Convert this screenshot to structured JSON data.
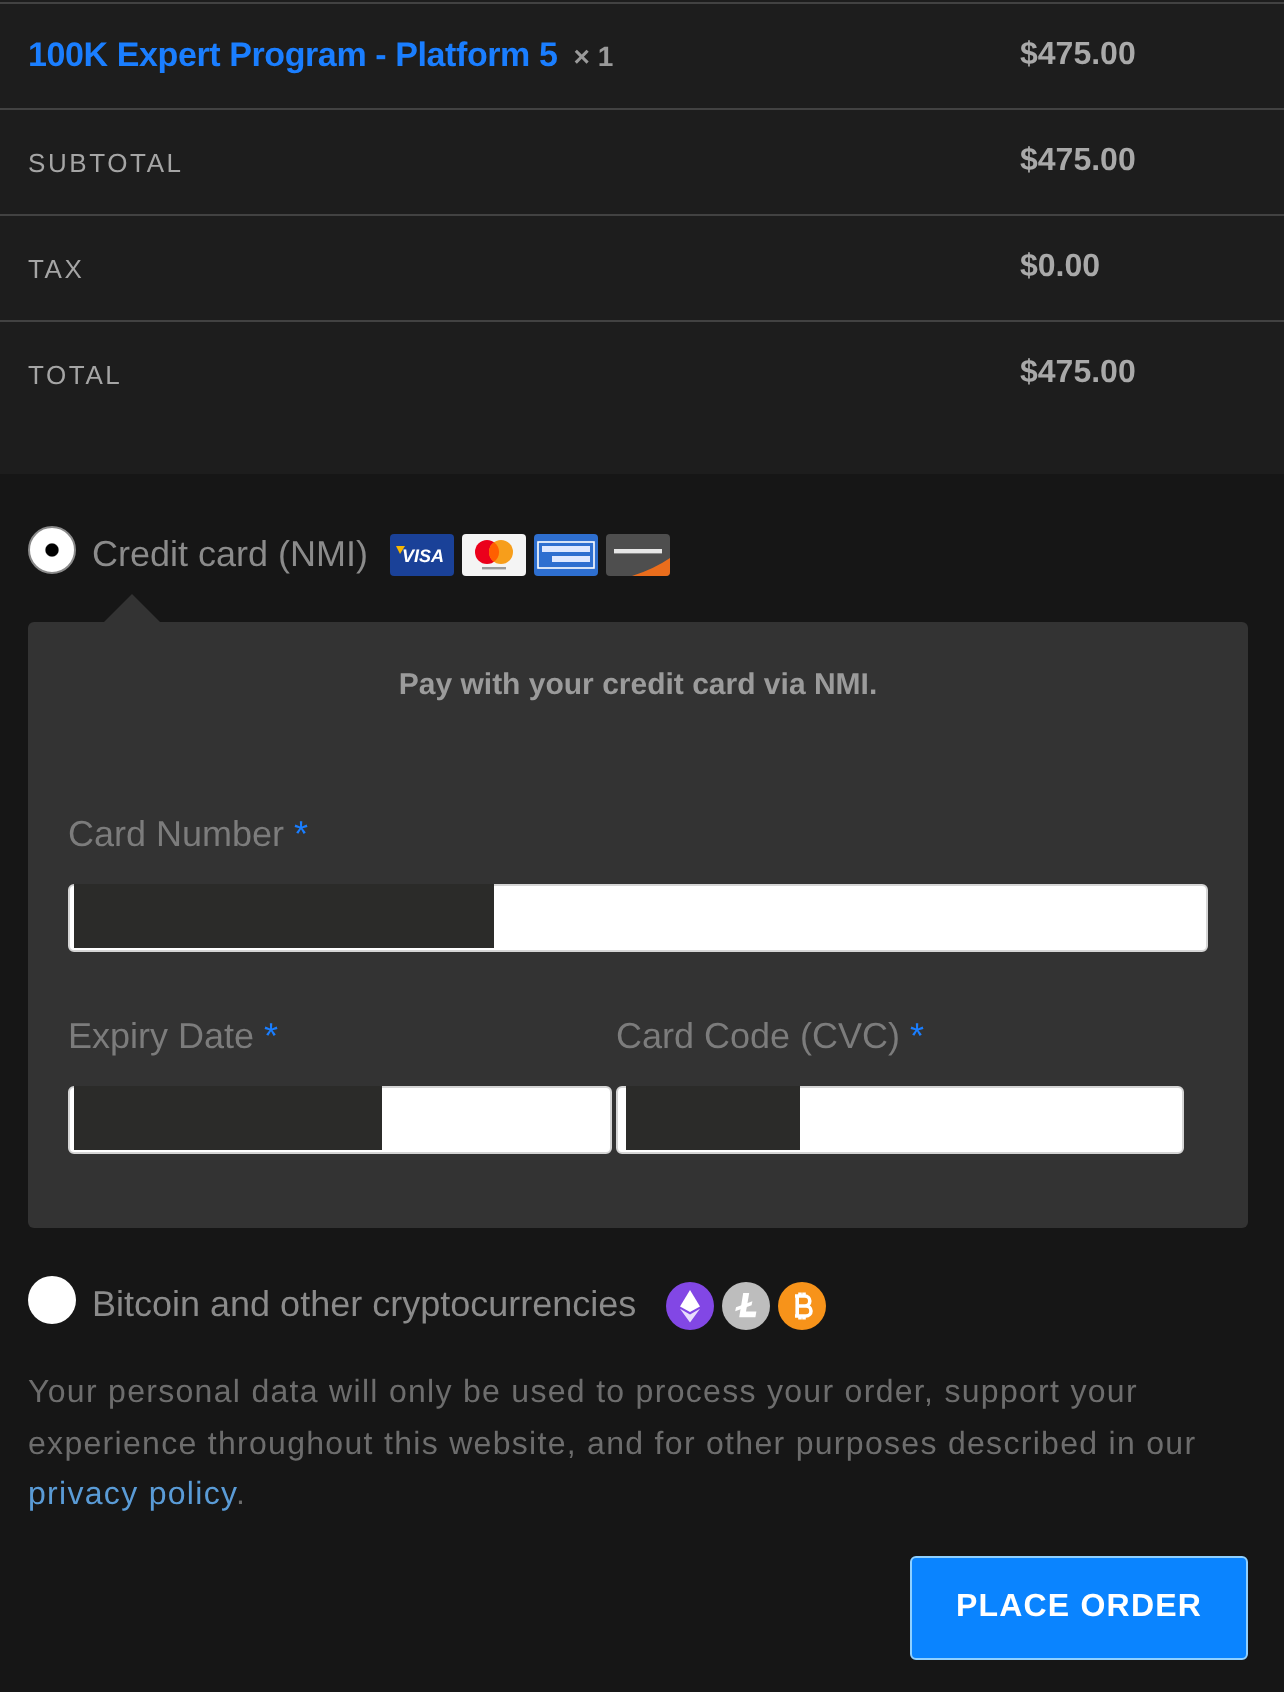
{
  "order_items": [
    {
      "name": "100K Expert Program - Platform 5",
      "quantity": "× 1",
      "price": "$475.00"
    }
  ],
  "totals": [
    {
      "label": "SUBTOTAL",
      "value": "$475.00"
    },
    {
      "label": "TAX",
      "value": "$0.00"
    },
    {
      "label": "TOTAL",
      "value": "$475.00"
    }
  ],
  "payment_methods": [
    {
      "kind": "card",
      "label": "Credit card (NMI)",
      "selected": true,
      "logos": [
        {
          "kind": "visa",
          "text": "VISA"
        },
        {
          "kind": "mastercard"
        },
        {
          "kind": "amex"
        },
        {
          "kind": "discover"
        }
      ],
      "panel": {
        "intro": "Pay with your credit card via NMI.",
        "fields": [
          {
            "label": "Card Number",
            "required_mark": "*"
          },
          {
            "label": "Expiry Date",
            "required_mark": "*"
          },
          {
            "label": "Card Code (CVC)",
            "required_mark": "*"
          }
        ]
      }
    },
    {
      "kind": "crypto",
      "label": "Bitcoin and other cryptocurrencies",
      "selected": false,
      "logos": [
        {
          "kind": "ethereum"
        },
        {
          "kind": "litecoin"
        },
        {
          "kind": "bitcoin"
        }
      ]
    }
  ],
  "privacy_notice": {
    "text": "Your personal data will only be used to process your order, support your experience throughout this website, and for other purposes described in our",
    "link": "privacy policy",
    "after": "."
  },
  "place_order_button": "PLACE ORDER"
}
